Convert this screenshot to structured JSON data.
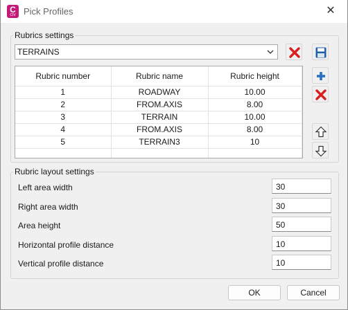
{
  "window": {
    "title": "Pick Profiles",
    "app_icon_letter": "C",
    "app_icon_sub": "CIV"
  },
  "rubrics": {
    "group_label": "Rubrics settings",
    "selected": "TERRAINS",
    "columns": [
      "Rubric number",
      "Rubric name",
      "Rubric height"
    ],
    "rows": [
      [
        "1",
        "ROADWAY",
        "10.00"
      ],
      [
        "2",
        "FROM.AXIS",
        "8.00"
      ],
      [
        "3",
        "TERRAIN",
        "10.00"
      ],
      [
        "4",
        "FROM.AXIS",
        "8.00"
      ],
      [
        "5",
        "TERRAIN3",
        "10"
      ],
      [
        "",
        "",
        ""
      ]
    ]
  },
  "layout": {
    "group_label": "Rubric layout settings",
    "fields": [
      {
        "label": "Left area width",
        "value": "30"
      },
      {
        "label": "Right area width",
        "value": "30"
      },
      {
        "label": "Area height",
        "value": "50"
      },
      {
        "label": "Horizontal profile distance",
        "value": "10"
      },
      {
        "label": "Vertical profile distance",
        "value": "10"
      }
    ]
  },
  "buttons": {
    "ok": "OK",
    "cancel": "Cancel"
  },
  "icons": {
    "delete": "red-x-icon",
    "save": "floppy-disk-icon",
    "add": "blue-plus-icon",
    "move_up": "arrow-up-icon",
    "move_down": "arrow-down-icon"
  },
  "colors": {
    "delete_red": "#d81e1e",
    "save_blue": "#1f5fa8",
    "add_blue": "#2a6fc1",
    "app_icon": "#c4197a"
  }
}
